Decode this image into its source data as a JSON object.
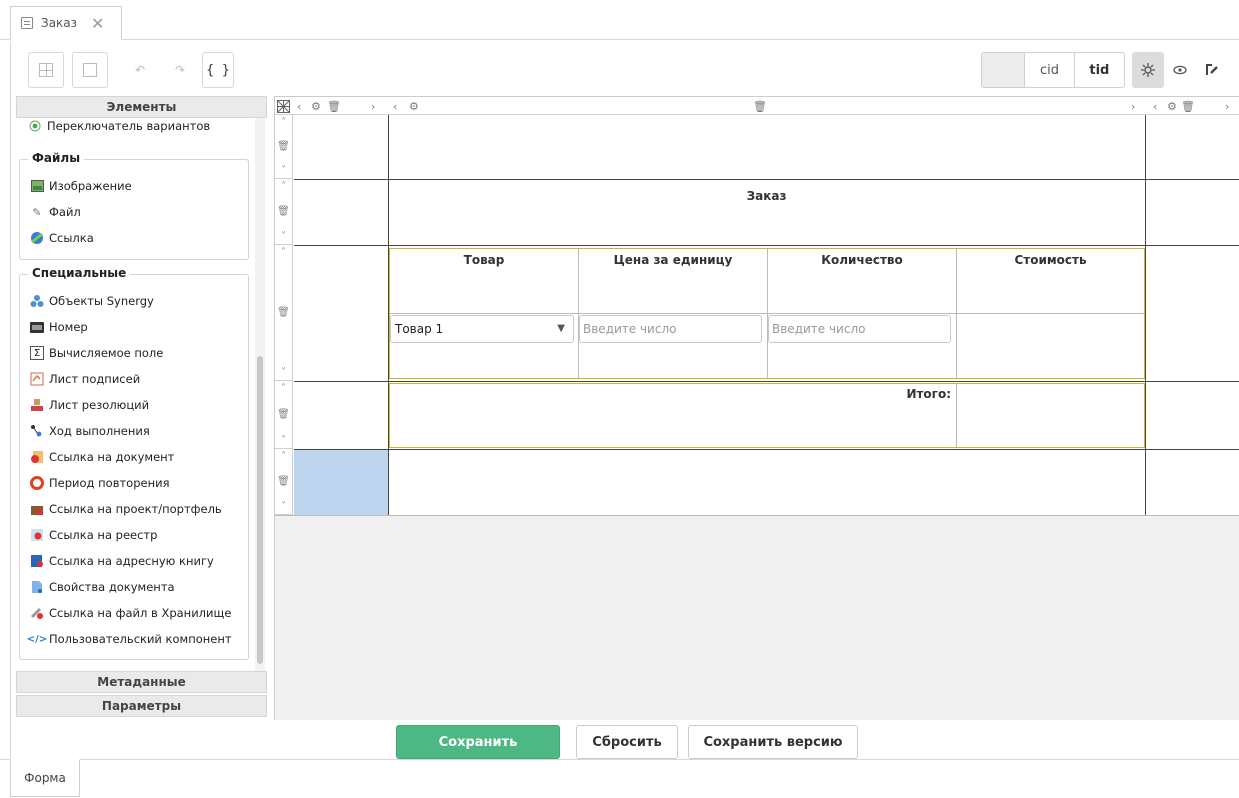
{
  "tab": {
    "title": "Заказ"
  },
  "toolbar": {
    "json_label": "{ }",
    "cid_label": "cid",
    "tid_label": "tid"
  },
  "left_panel": {
    "header": "Элементы",
    "partial_item": "Переключатель вариантов",
    "groups": [
      {
        "title": "Файлы",
        "items": [
          {
            "label": "Изображение",
            "icon": "image-icon"
          },
          {
            "label": "Файл",
            "icon": "paperclip-icon"
          },
          {
            "label": "Ссылка",
            "icon": "link-icon"
          }
        ]
      },
      {
        "title": "Специальные",
        "items": [
          {
            "label": "Объекты Synergy",
            "icon": "objects-icon"
          },
          {
            "label": "Номер",
            "icon": "number-icon"
          },
          {
            "label": "Вычисляемое поле",
            "icon": "sigma-icon"
          },
          {
            "label": "Лист подписей",
            "icon": "signatures-icon"
          },
          {
            "label": "Лист резолюций",
            "icon": "resolutions-icon"
          },
          {
            "label": "Ход выполнения",
            "icon": "progress-icon"
          },
          {
            "label": "Ссылка на документ",
            "icon": "doc-link-icon"
          },
          {
            "label": "Период повторения",
            "icon": "repeat-icon"
          },
          {
            "label": "Ссылка на проект/портфель",
            "icon": "project-link-icon"
          },
          {
            "label": "Ссылка на реестр",
            "icon": "registry-link-icon"
          },
          {
            "label": "Ссылка на адресную книгу",
            "icon": "addressbook-link-icon"
          },
          {
            "label": "Свойства документа",
            "icon": "doc-properties-icon"
          },
          {
            "label": "Ссылка на файл в Хранилище",
            "icon": "storage-link-icon"
          },
          {
            "label": "Пользовательский компонент",
            "icon": "custom-component-icon"
          }
        ]
      }
    ],
    "metadata_label": "Метаданные",
    "params_label": "Параметры"
  },
  "form": {
    "title": "Заказ",
    "headers": [
      "Товар",
      "Цена за единицу",
      "Количество",
      "Стоимость"
    ],
    "product_value": "Товар 1",
    "price_placeholder": "Введите число",
    "quantity_placeholder": "Введите число",
    "total_label": "Итого:"
  },
  "buttons": {
    "save": "Сохранить",
    "reset": "Сбросить",
    "save_version": "Сохранить версию"
  },
  "bottom_tab": {
    "label": "Форма"
  }
}
